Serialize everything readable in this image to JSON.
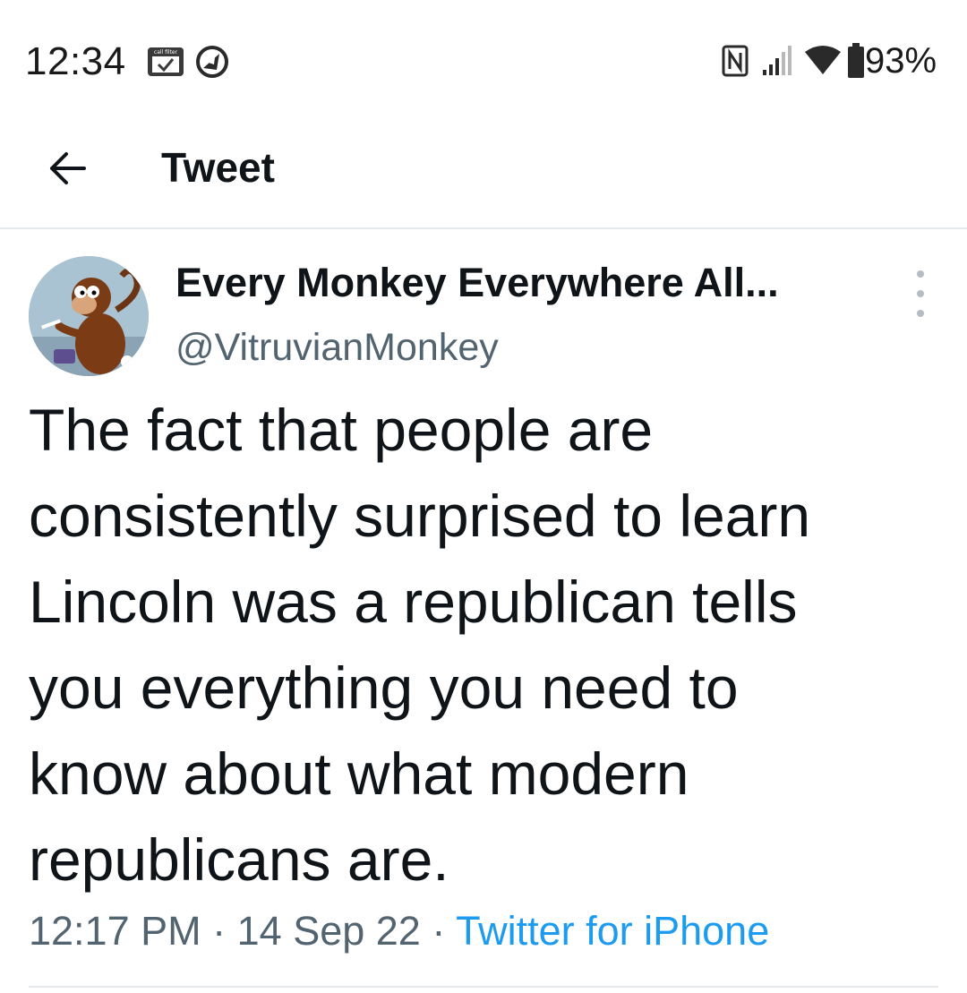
{
  "status_bar": {
    "time": "12:34",
    "callfilter_label": "call filter",
    "battery_percent": "93%",
    "icons": [
      "callfilter-icon",
      "sync-icon",
      "nfc-icon",
      "signal-icon",
      "wifi-icon",
      "battery-icon"
    ]
  },
  "header": {
    "title": "Tweet",
    "back_icon": "arrow-left-icon"
  },
  "tweet": {
    "author": {
      "display_name": "Every Monkey Everywhere All...",
      "handle": "@VitruvianMonkey"
    },
    "text_lines": [
      "The fact that people are",
      "consistently surprised to learn",
      "Lincoln was a republican tells",
      "you everything you need to",
      "know about what modern",
      "republicans are."
    ],
    "time": "12:17 PM",
    "date": "14 Sep 22",
    "separator": "·",
    "source": "Twitter for iPhone"
  },
  "colors": {
    "text_primary": "#0f1419",
    "text_secondary": "#536471",
    "link": "#1d9bf0",
    "divider": "#e6e9eb"
  }
}
